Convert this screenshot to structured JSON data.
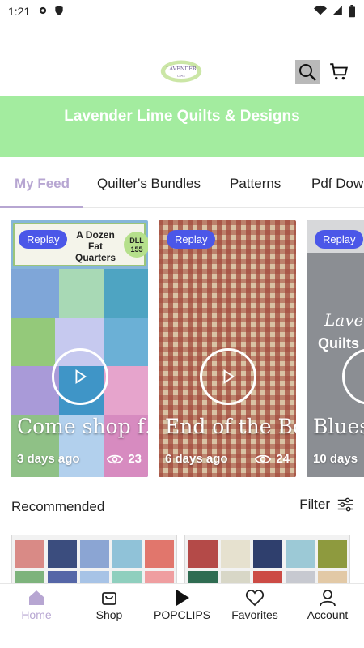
{
  "status_bar": {
    "time": "1:21"
  },
  "header": {
    "logo_alt": "Lavender Lime logo"
  },
  "banner": {
    "title": "Lavender Lime Quilts & Designs",
    "bg": "#a3ec9f"
  },
  "tabs": [
    {
      "label": "My Feed",
      "active": true
    },
    {
      "label": "Quilter's Bundles"
    },
    {
      "label": "Patterns"
    },
    {
      "label": "Pdf Dow"
    }
  ],
  "cards": [
    {
      "replay": "Replay",
      "title": "Come shop f…",
      "age": "3 days ago",
      "views": "23",
      "overlay": {
        "line1": "A Dozen",
        "line2": "Fat",
        "line3": "Quarters",
        "badge": "DLL\n155"
      }
    },
    {
      "replay": "Replay",
      "title": "End of the Bo…",
      "age": "6 days ago",
      "views": "24"
    },
    {
      "replay": "Replay",
      "title": "Blues",
      "age": "10 days",
      "overlay_text": "Laven Quilts"
    }
  ],
  "recommended": {
    "label": "Recommended",
    "filter": "Filter"
  },
  "nav": [
    {
      "label": "Home",
      "icon": "home-icon",
      "active": true
    },
    {
      "label": "Shop",
      "icon": "shop-icon"
    },
    {
      "label": "POPCLIPS",
      "icon": "play-icon"
    },
    {
      "label": "Favorites",
      "icon": "heart-icon"
    },
    {
      "label": "Account",
      "icon": "person-icon"
    }
  ],
  "colors": {
    "accent": "#b7a6d2",
    "replay": "#4b57e8"
  }
}
